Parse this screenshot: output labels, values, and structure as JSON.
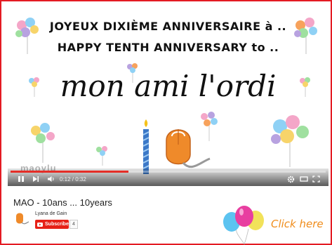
{
  "video": {
    "line1": "JOYEUX DIXIÈME ANNIVERSAIRE à ..",
    "line2": "HAPPY TENTH ANNIVERSARY to ..",
    "main_text": "mon ami l'ordi",
    "watermark": "maoylu",
    "time_display": "0:12 / 0:32",
    "progress": 0.375,
    "icons": [
      "play-icon",
      "next-icon",
      "volume-icon",
      "settings-icon",
      "theater-mode-icon",
      "fullscreen-icon"
    ]
  },
  "info": {
    "title": "MAO - 10ans ... 10years",
    "channel_name": "Lyana de Gain",
    "subscribe_label": "Subscribe",
    "subscriber_count": "4"
  },
  "promo": {
    "label": "Click here"
  },
  "colors": {
    "border": "#e31b23",
    "subscribe": "#e62117",
    "progress": "#e52d27",
    "click_here": "#f08c1a"
  }
}
